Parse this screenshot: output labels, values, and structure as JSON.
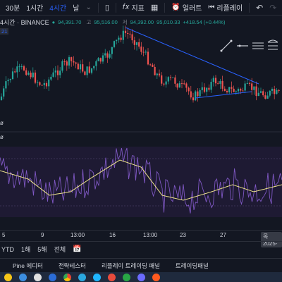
{
  "toolbar": {
    "intervals": [
      "30분",
      "1시간",
      "4시간",
      "날"
    ],
    "active_interval": "4시간",
    "indicators_label": "지표",
    "alert_label": "얼러트",
    "replay_label": "리플레이"
  },
  "legend": {
    "symbol": "4시간 · BINANCE",
    "high_label": "고",
    "low_label": "저",
    "value_left": "94,391.70",
    "high": "95,516.00",
    "low": "94,392.00",
    "close_fragment": "95,010.33",
    "change": "+418.54 (+0.44%)",
    "badge": "21"
  },
  "indicator": {
    "label": "ø"
  },
  "time_axis": {
    "labels": [
      "5",
      "9",
      "13:00",
      "16",
      "13:00",
      "23",
      "27"
    ],
    "date_badge": "목 2025-"
  },
  "range_bar": {
    "items": [
      "YTD",
      "1해",
      "5해",
      "전체"
    ],
    "calendar_icon": "calendar-icon"
  },
  "bottom_tabs": {
    "items": [
      "Pine 에디터",
      "전략테스터",
      "리플레이 트레이딩 패널",
      "트레이딩패널"
    ]
  },
  "colors": {
    "up": "#26a69a",
    "down": "#ef5350",
    "trendline": "#2962ff",
    "indicator_line": "#7e57c2",
    "indicator_ma": "#f0e68c",
    "indicator_bg": "#1e1a33"
  }
}
